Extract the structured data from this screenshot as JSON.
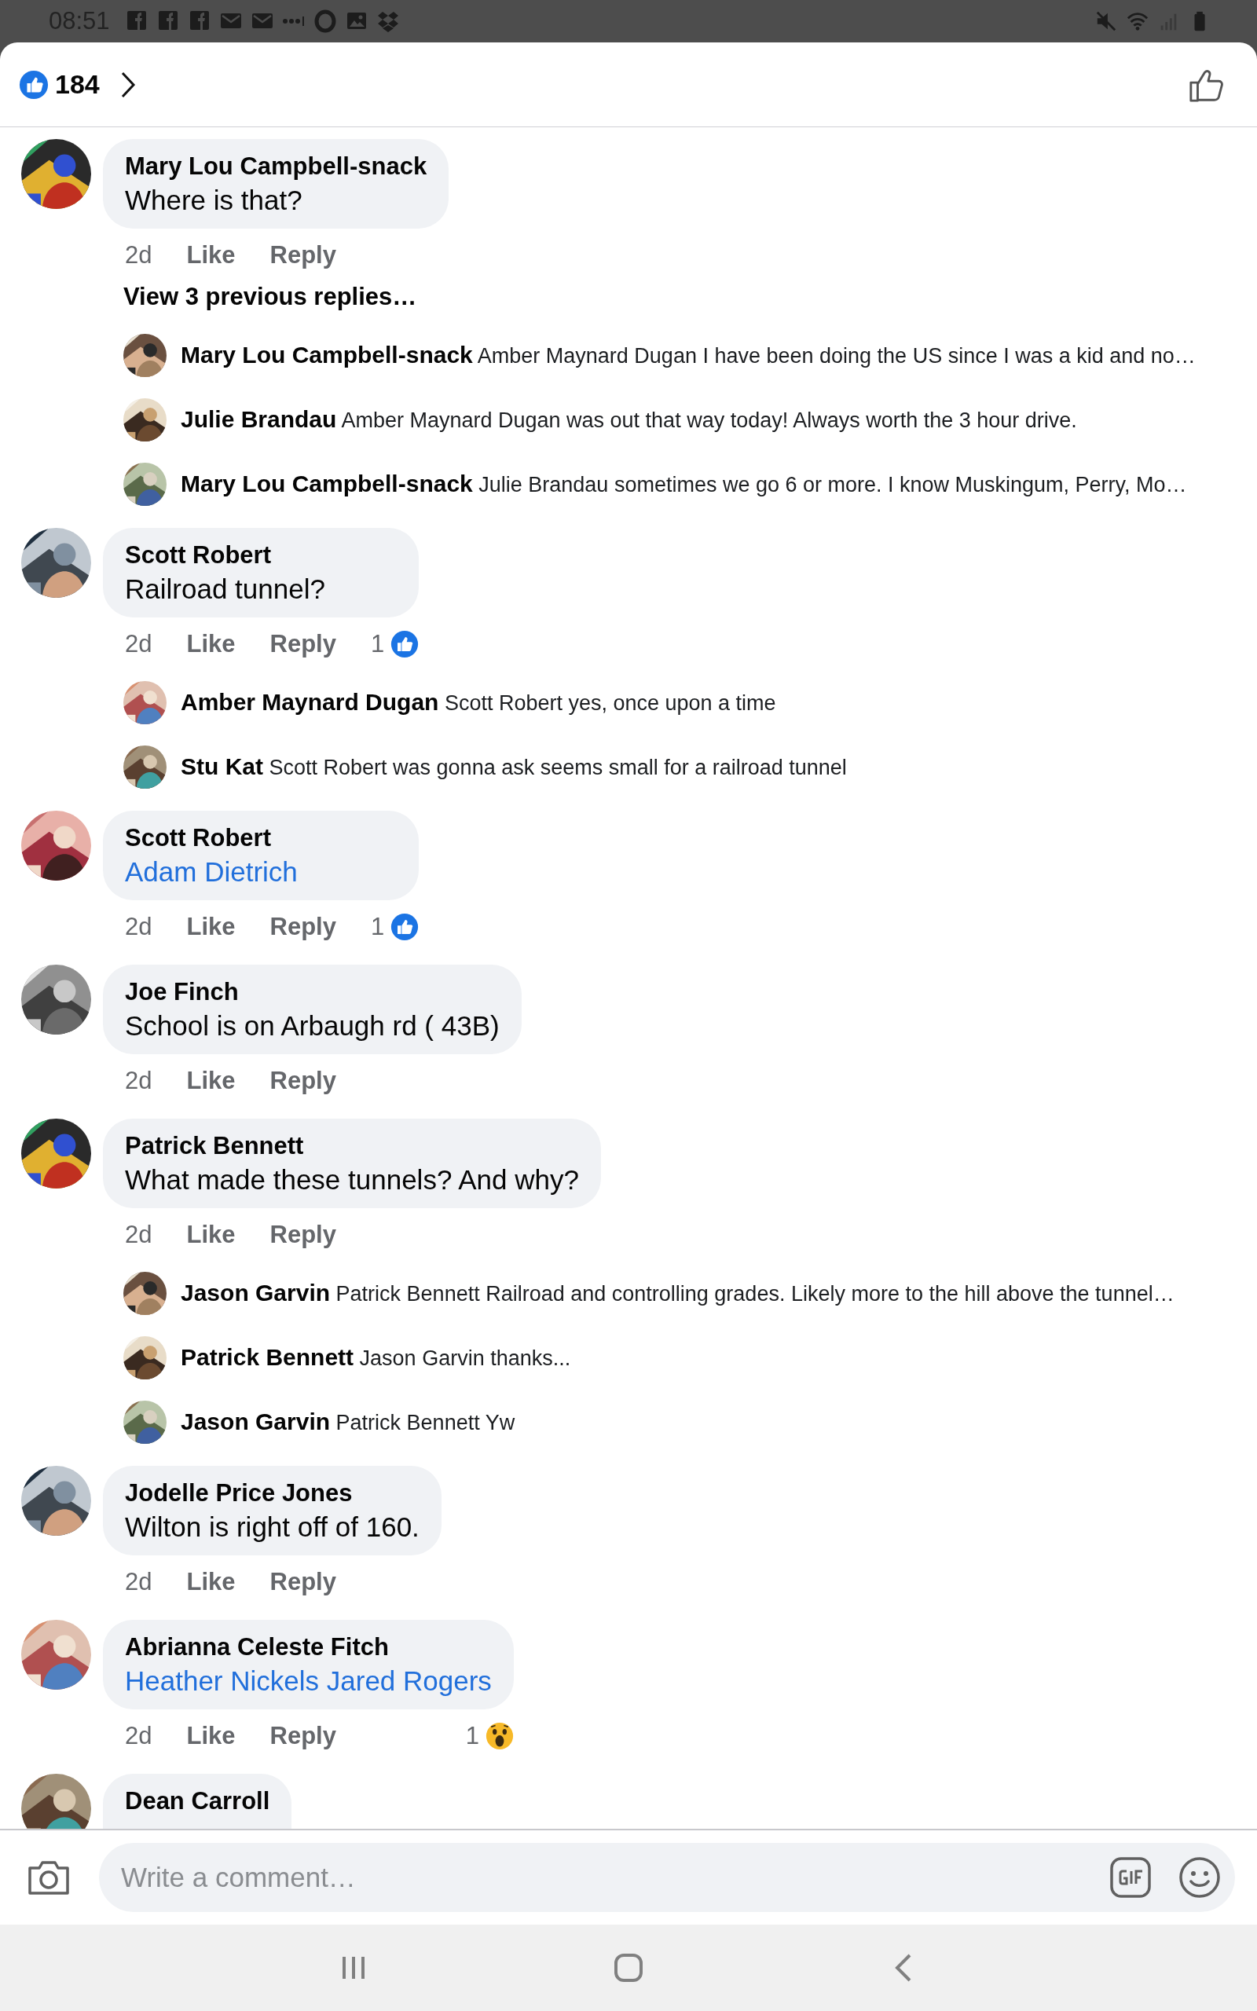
{
  "status_bar": {
    "time": "08:51"
  },
  "header": {
    "reaction_count": "184"
  },
  "comments": [
    {
      "author": "Mary Lou Campbell-snack",
      "text": "Where is that?",
      "kind": "plain",
      "time": "2d",
      "actions": [
        "Like",
        "Reply"
      ],
      "view_more": "View 3 previous replies…",
      "replies": [
        {
          "author": "Mary Lou Campbell-snack",
          "text": "Amber Maynard Dugan I have been doing the US since I was a kid and no…"
        },
        {
          "author": "Julie Brandau",
          "text": "Amber Maynard Dugan was out that way today! Always worth the 3 hour drive."
        },
        {
          "author": "Mary Lou Campbell-snack",
          "text": "Julie Brandau sometimes we go 6 or more. I know Muskingum, Perry, Mo…"
        }
      ]
    },
    {
      "author": "Scott Robert",
      "text": "Railroad tunnel?",
      "kind": "plain",
      "time": "2d",
      "actions": [
        "Like",
        "Reply"
      ],
      "reaction": {
        "kind": "like",
        "count": "1"
      },
      "replies": [
        {
          "author": "Amber Maynard Dugan",
          "text": "Scott Robert yes, once upon a time"
        },
        {
          "author": "Stu Kat",
          "text": "Scott Robert was gonna ask seems small for a railroad tunnel"
        }
      ]
    },
    {
      "author": "Scott Robert",
      "text": "Adam Dietrich",
      "kind": "mention",
      "time": "2d",
      "actions": [
        "Like",
        "Reply"
      ],
      "reaction": {
        "kind": "like",
        "count": "1"
      }
    },
    {
      "author": "Joe Finch",
      "text": "School is on Arbaugh rd ( 43B)",
      "kind": "plain",
      "time": "2d",
      "actions": [
        "Like",
        "Reply"
      ]
    },
    {
      "author": "Patrick Bennett",
      "text": "What made these tunnels? And why?",
      "kind": "plain",
      "time": "2d",
      "actions": [
        "Like",
        "Reply"
      ],
      "replies": [
        {
          "author": "Jason Garvin",
          "text": "Patrick Bennett Railroad and controlling grades. Likely more to the hill above the tunnel…"
        },
        {
          "author": "Patrick Bennett",
          "text": "Jason Garvin thanks..."
        },
        {
          "author": "Jason Garvin",
          "text": "Patrick Bennett Yw"
        }
      ]
    },
    {
      "author": "Jodelle Price Jones",
      "text": "Wilton is right off of 160.",
      "kind": "plain",
      "time": "2d",
      "actions": [
        "Like",
        "Reply"
      ]
    },
    {
      "author": "Abrianna Celeste Fitch",
      "text": "Heather Nickels Jared Rogers",
      "kind": "mention",
      "time": "2d",
      "actions": [
        "Like",
        "Reply"
      ],
      "reaction": {
        "kind": "wow",
        "count": "1"
      }
    },
    {
      "author": "Dean Carroll"
    }
  ],
  "composer": {
    "placeholder": "Write a comment…"
  }
}
